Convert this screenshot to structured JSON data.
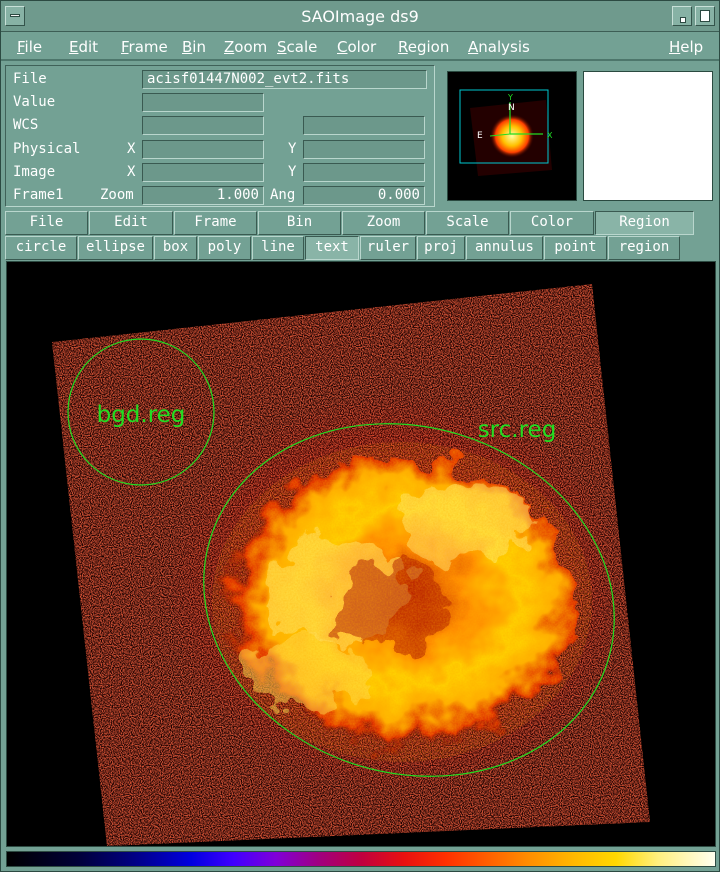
{
  "window": {
    "title": "SAOImage ds9"
  },
  "menubar": {
    "items": [
      "File",
      "Edit",
      "Frame",
      "Bin",
      "Zoom",
      "Scale",
      "Color",
      "Region",
      "Analysis"
    ],
    "help": "Help"
  },
  "info": {
    "file_label": "File",
    "file_value": "acisf01447N002_evt2.fits",
    "value_label": "Value",
    "value_value": "",
    "wcs_label": "WCS",
    "physical_label": "Physical",
    "image_label": "Image",
    "frame_label": "Frame1",
    "x_label": "X",
    "y_label": "Y",
    "zoom_label": "Zoom",
    "zoom_value": "1.000",
    "ang_label": "Ang",
    "ang_value": "0.000"
  },
  "panner": {
    "n_label": "N",
    "e_label": "E",
    "y_label": "Y",
    "x_label": "X"
  },
  "buttonbar_main": [
    "File",
    "Edit",
    "Frame",
    "Bin",
    "Zoom",
    "Scale",
    "Color",
    "Region"
  ],
  "buttonbar_main_active": "Region",
  "buttonbar_region": [
    "circle",
    "ellipse",
    "box",
    "poly",
    "line",
    "text",
    "ruler",
    "proj",
    "annulus",
    "point",
    "region"
  ],
  "buttonbar_region_active": "text",
  "regions": {
    "bgd_label": "bgd.reg",
    "src_label": "src.reg",
    "color": "#22dd22"
  },
  "colormap": "heat"
}
